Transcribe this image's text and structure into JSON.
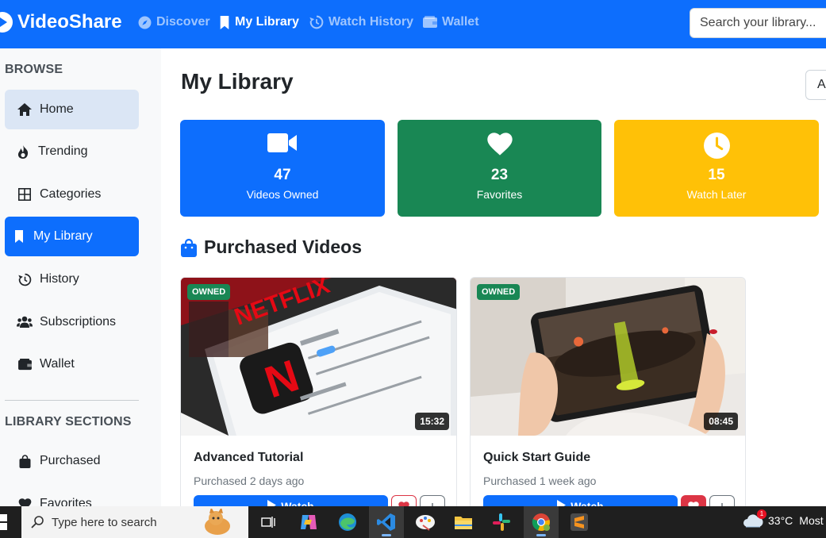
{
  "app": {
    "brand": "VideoShare",
    "accent_color": "#0d6efd",
    "nav": [
      {
        "label": "Discover",
        "icon": "compass-icon",
        "active": false
      },
      {
        "label": "My Library",
        "icon": "bookmark-icon",
        "active": true
      },
      {
        "label": "Watch History",
        "icon": "history-icon",
        "active": false
      },
      {
        "label": "Wallet",
        "icon": "wallet-icon",
        "active": false
      }
    ],
    "search_placeholder": "Search your library..."
  },
  "sidebar": {
    "browse_heading": "BROWSE",
    "browse_items": [
      {
        "label": "Home",
        "icon": "home-icon"
      },
      {
        "label": "Trending",
        "icon": "fire-icon"
      },
      {
        "label": "Categories",
        "icon": "grid-icon"
      },
      {
        "label": "My Library",
        "icon": "bookmark-icon",
        "active": true
      },
      {
        "label": "History",
        "icon": "history-icon"
      },
      {
        "label": "Subscriptions",
        "icon": "users-icon"
      },
      {
        "label": "Wallet",
        "icon": "wallet-icon"
      }
    ],
    "library_heading": "LIBRARY SECTIONS",
    "library_items": [
      {
        "label": "Purchased",
        "icon": "shopping-bag-icon"
      },
      {
        "label": "Favorites",
        "icon": "heart-icon"
      }
    ]
  },
  "main": {
    "title": "My Library",
    "filter_value": "Al",
    "stats": [
      {
        "value": "47",
        "label": "Videos Owned",
        "icon": "video-camera-icon",
        "color": "#0d6efd"
      },
      {
        "value": "23",
        "label": "Favorites",
        "icon": "heart-icon",
        "color": "#198754"
      },
      {
        "value": "15",
        "label": "Watch Later",
        "icon": "clock-icon",
        "color": "#ffc107"
      }
    ],
    "section_title": "Purchased Videos",
    "cards": [
      {
        "badge": "OWNED",
        "duration": "15:32",
        "title": "Advanced Tutorial",
        "meta": "Purchased 2 days ago",
        "watch_label": "Watch"
      },
      {
        "badge": "OWNED",
        "duration": "08:45",
        "title": "Quick Start Guide",
        "meta": "Purchased 1 week ago",
        "watch_label": "Watch"
      }
    ]
  },
  "taskbar": {
    "search_placeholder": "Type here to search",
    "apps": [
      "task-view-icon",
      "copilot-icon",
      "edge-icon",
      "vscode-icon",
      "paint-icon",
      "file-explorer-icon",
      "slack-icon",
      "chrome-icon",
      "sublime-text-icon"
    ],
    "weather_temp": "33°C",
    "weather_text": "Most",
    "weather_badge": "1"
  }
}
